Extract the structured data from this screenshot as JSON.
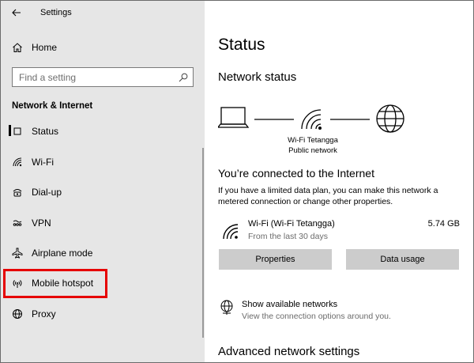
{
  "window": {
    "title": "Settings"
  },
  "sidebar": {
    "home_label": "Home",
    "search": {
      "placeholder": "Find a setting",
      "value": ""
    },
    "section_heading": "Network & Internet",
    "items": [
      {
        "label": "Status",
        "icon": "status-icon"
      },
      {
        "label": "Wi-Fi",
        "icon": "wifi-icon"
      },
      {
        "label": "Dial-up",
        "icon": "dialup-icon"
      },
      {
        "label": "VPN",
        "icon": "vpn-icon"
      },
      {
        "label": "Airplane mode",
        "icon": "airplane-icon"
      },
      {
        "label": "Mobile hotspot",
        "icon": "mobile-hotspot-icon"
      },
      {
        "label": "Proxy",
        "icon": "globe-icon"
      }
    ],
    "highlight_color": "#e60000"
  },
  "main": {
    "title": "Status",
    "network_status_heading": "Network status",
    "diagram": {
      "network_name": "Wi-Fi Tetangga",
      "network_type": "Public network"
    },
    "connected_title": "You’re connected to the Internet",
    "connected_desc": "If you have a limited data plan, you can make this network a metered connection or change other properties.",
    "connection": {
      "name": "Wi-Fi (Wi-Fi Tetangga)",
      "period": "From the last 30 days",
      "usage": "5.74 GB"
    },
    "buttons": {
      "properties": "Properties",
      "data_usage": "Data usage"
    },
    "show_networks": {
      "title": "Show available networks",
      "subtitle": "View the connection options around you."
    },
    "advanced_heading": "Advanced network settings"
  }
}
